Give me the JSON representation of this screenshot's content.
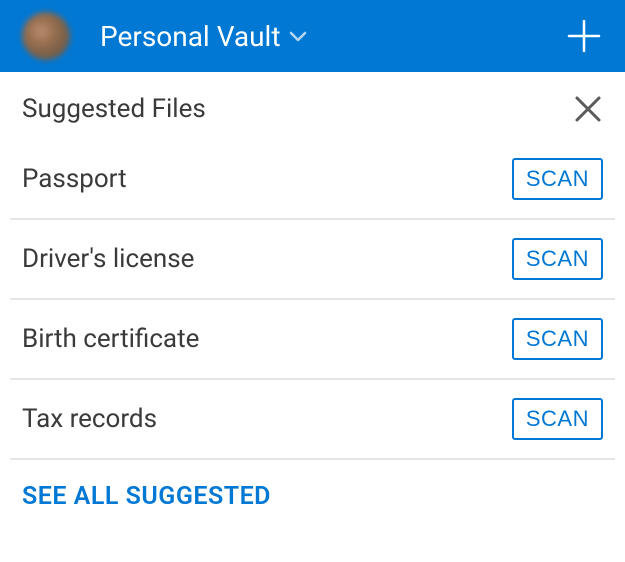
{
  "header": {
    "title": "Personal Vault"
  },
  "section": {
    "title": "Suggested Files"
  },
  "items": [
    {
      "label": "Passport",
      "action": "SCAN"
    },
    {
      "label": "Driver's license",
      "action": "SCAN"
    },
    {
      "label": "Birth certificate",
      "action": "SCAN"
    },
    {
      "label": "Tax records",
      "action": "SCAN"
    }
  ],
  "see_all": "SEE ALL SUGGESTED"
}
